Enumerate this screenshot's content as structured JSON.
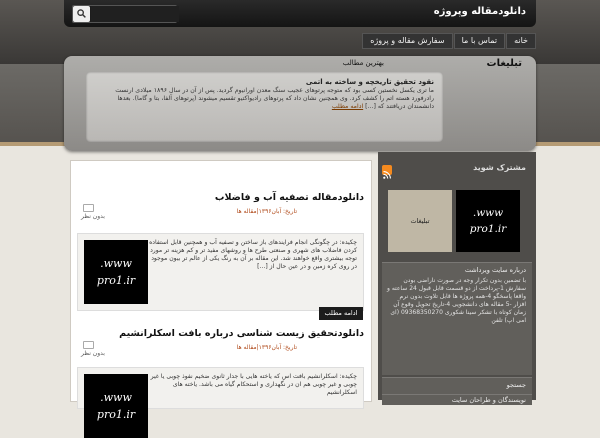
{
  "site": {
    "title": "دانلودمقاله وپروژه"
  },
  "search": {
    "placeholder": ""
  },
  "nav": {
    "items": [
      "خانه",
      "تماس با ما",
      "سفارش مقاله و پروژه"
    ]
  },
  "ads": {
    "title": "تبلیغات"
  },
  "best": {
    "section_title": "بهترین مطالب",
    "head": "نقود تحقیق تاریخچه و ساخته به اتمی",
    "body": "ما تری یکسل نخستین کسی بود که متوجه پرتوهای عجیب سنگ معدن اورانیوم گردید. پس از آن در سال ۱۸۹۶ میلادی ارنست رادرفورد هسته اتم را کشف کرد. وی همچنین نشان داد که پرتوهای رادیواکتیو تقسیم میشوند (پرتوهای آلفا، بتا و گاما). بعدها دانشمندان دریافتند که [...]",
    "more": "ادامه مطلب"
  },
  "posts": [
    {
      "title": "دانلودمقاله تصفیه آب و فاضلاب",
      "meta": "تاریخ: آبان۱۳۹۶|مقاله ها",
      "comments": "بدون نظر",
      "thumb": [
        "www.",
        "pro1.ir"
      ],
      "excerpt": "چکیده: در چگونگی انجام فرایندهای باز ساختن و تصفیه آب و همچنین قابل استفاده کردن فاضلاب های شهری و صنعتی طرح ها و روشهای مفید تر و کم هزینه تر مورد توجه بیشتری واقع خواهند شد. این مقاله بر آن به رنگ یکی از عالم تر بیون موجود در روی کره زمین و در عین حال از [...]",
      "more": "ادامه مطلب"
    },
    {
      "title": "دانلودتحقیق زیست شناسی درباره بافت اسکلرانشیم",
      "meta": "تاریخ: آبان۱۳۹۶|مقاله ها",
      "comments": "بدون نظر",
      "thumb": [
        "www.",
        "pro1.ir"
      ],
      "excerpt": "چکیده: اسکلرانشیم بافت اس که یاخته هایی با جدار ثانوی ضخیم نفوذ چوبی یا غیر چوبی و غیر چوبی هم ان در نگهداری و استحکام گیاه می باشد. یاخته های اسکلرانشیم"
    }
  ],
  "sidebar": {
    "subscribe_title": "مشترک شوید",
    "banner_a": [
      "www.",
      "pro1.ir"
    ],
    "banner_b": "تبلیغات",
    "about_title": "درباره سایت ویرداشت",
    "about_text": "با تضمین بدون تکرار وجه در صورت ناراضی بودن سفارش 1-پرداخت از دو قسمت قابل قبول 24 ساعته و واقعا پاسخگو 4-همه پروژه ها قابل تلاوت بدون نرم افزار -5 مقاله های دانشجویی 4-تاریخ تحویل وقوع آن زمان کوتاه با تشکر سینا شکوری 09368350270 (ای امی اپ) تلفن",
    "search_title": "جستجو",
    "authors_title": "نویسندگان و طراحان سایت"
  }
}
